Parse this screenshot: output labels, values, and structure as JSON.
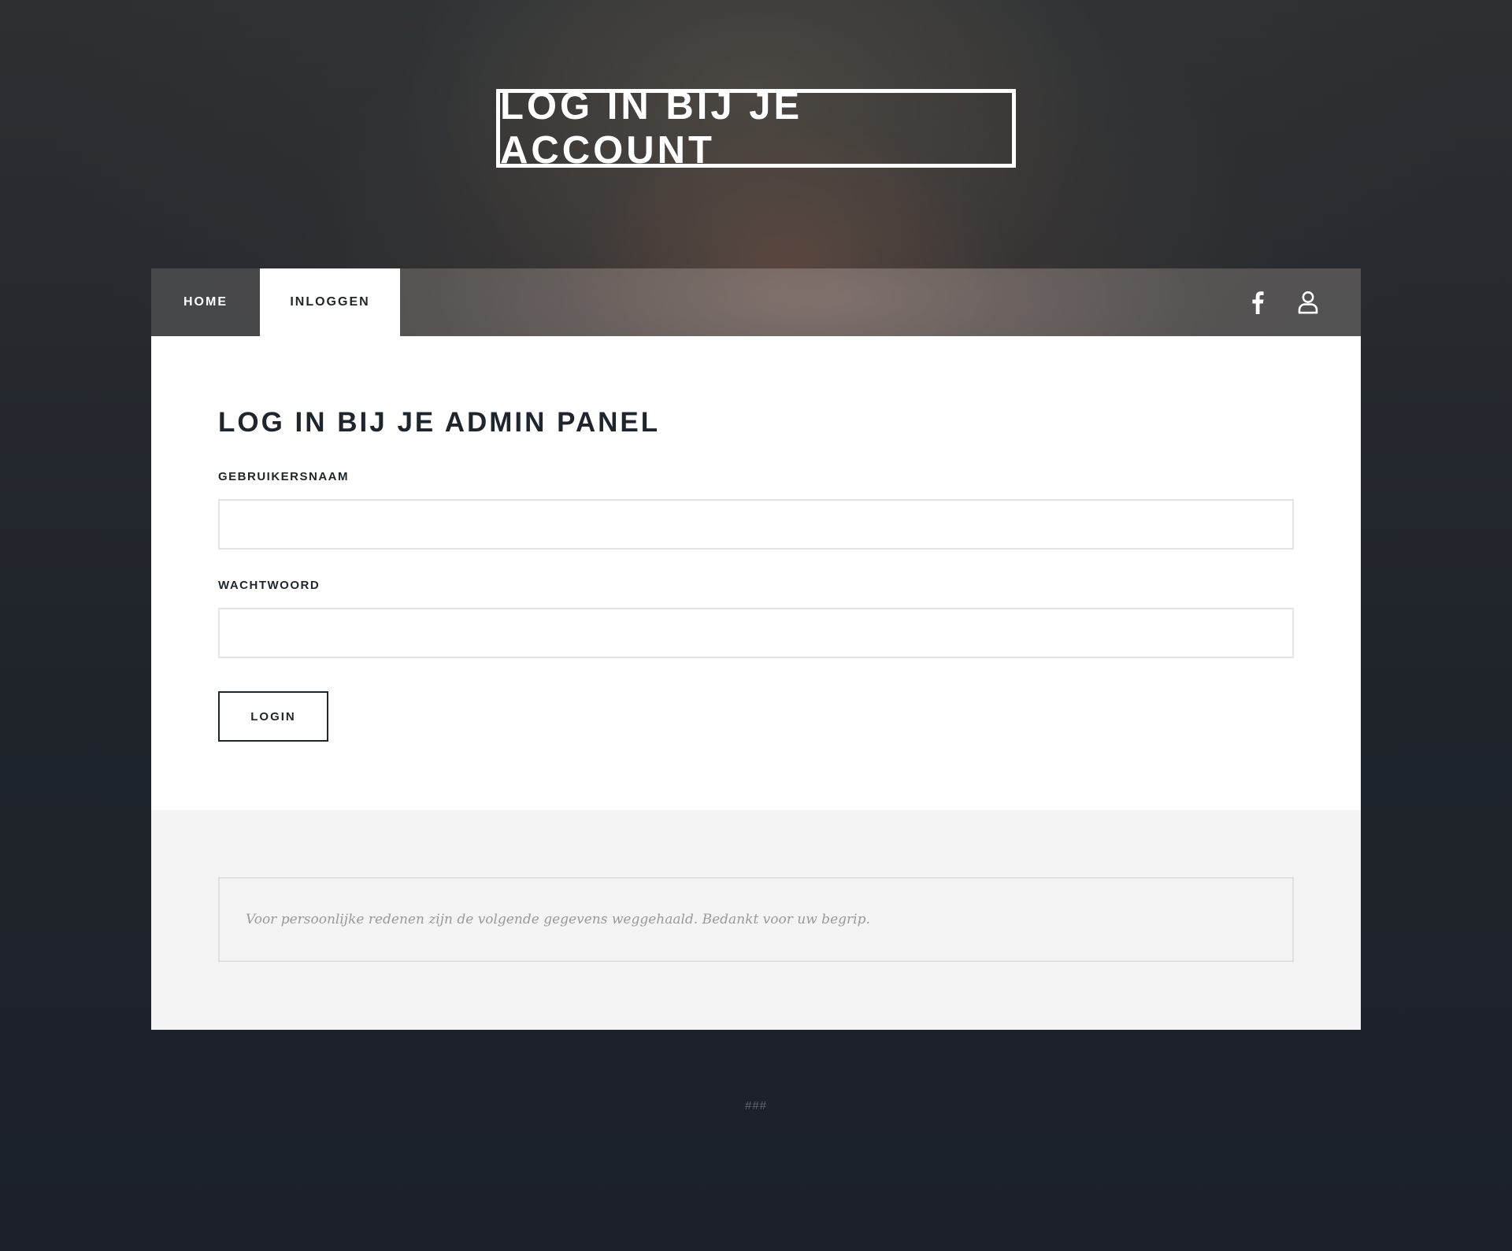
{
  "hero": {
    "title": "LOG IN BIJ JE ACCOUNT"
  },
  "nav": {
    "items": [
      {
        "label": "HOME",
        "active": false
      },
      {
        "label": "INLOGGEN",
        "active": true
      }
    ],
    "icons": [
      "facebook-icon",
      "user-icon"
    ]
  },
  "form": {
    "heading": "LOG IN BIJ JE ADMIN PANEL",
    "username_label": "GEBRUIKERSNAAM",
    "username_value": "",
    "username_placeholder": "",
    "password_label": "WACHTWOORD",
    "password_value": "",
    "password_placeholder": "",
    "submit_label": "LOGIN"
  },
  "notice": {
    "text": "Voor persoonlijke redenen zijn de volgende gegevens weggehaald. Bedankt voor uw begrip."
  },
  "footer": {
    "text": "###"
  },
  "colors": {
    "background_dark": "#1d222a",
    "text_dark": "#1f252d",
    "white": "#ffffff",
    "notice_background": "#f4f4f4",
    "notice_text": "#9a9a9a"
  }
}
